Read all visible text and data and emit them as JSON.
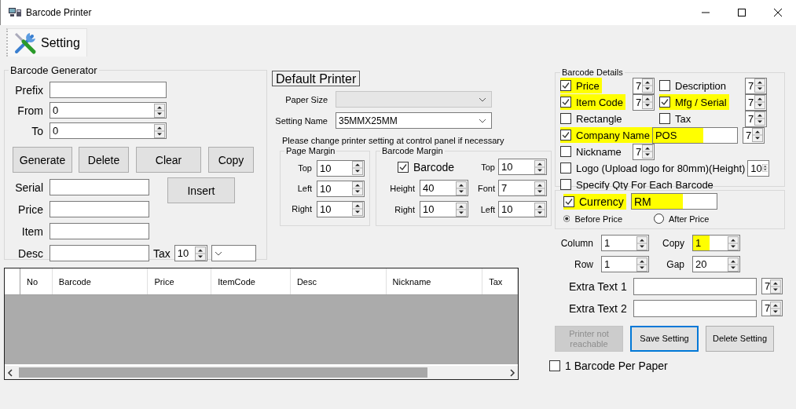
{
  "window": {
    "title": "Barcode Printer"
  },
  "toolbar": {
    "label": "Setting"
  },
  "generator": {
    "title": "Barcode Generator",
    "fields": [
      {
        "label": "Prefix",
        "kind": "text"
      },
      {
        "label": "From",
        "kind": "spin",
        "value": "0"
      },
      {
        "label": "To",
        "kind": "spin",
        "value": "0"
      }
    ],
    "buttons": [
      "Generate",
      "Delete",
      "Clear",
      "Copy"
    ],
    "item_fields": [
      {
        "label": "Serial"
      },
      {
        "label": "Price"
      },
      {
        "label": "Item"
      },
      {
        "label": "Desc"
      }
    ],
    "insert_button": "Insert",
    "tax": {
      "label": "Tax",
      "value": "10"
    }
  },
  "table": {
    "columns": [
      "No",
      "Barcode",
      "Price",
      "ItemCode",
      "Desc",
      "Nickname",
      "Tax"
    ]
  },
  "printer": {
    "title": "Default Printer",
    "paper_size": {
      "label": "Paper Size",
      "disabled": true
    },
    "setting_name": {
      "label": "Setting Name",
      "value": "35MMX25MM",
      "disabled": false
    },
    "note": "Please change printer setting at control panel if necessary",
    "page_margin": {
      "title": "Page Margin",
      "fields": [
        {
          "label": "Top",
          "value": "10"
        },
        {
          "label": "Left",
          "value": "10"
        },
        {
          "label": "Right",
          "value": "10"
        }
      ]
    },
    "barcode_margin": {
      "title": "Barcode Margin",
      "cells": [
        {
          "kind": "check",
          "label": "Barcode",
          "checked": true
        },
        {
          "kind": "spin",
          "label": "Top",
          "value": "10"
        },
        {
          "kind": "spin",
          "label": "Height",
          "value": "40"
        },
        {
          "kind": "spin",
          "label": "Font",
          "value": "7"
        },
        {
          "kind": "spin",
          "label": "Right",
          "value": "10"
        },
        {
          "kind": "spin",
          "label": "Left",
          "value": "10"
        }
      ]
    }
  },
  "details": {
    "title": "Barcode Details",
    "rows": [
      [
        {
          "kind": "check",
          "label": "Price",
          "checked": true,
          "highlighted": true
        },
        {
          "kind": "spin",
          "value": "7"
        },
        {
          "kind": "check",
          "label": "Description",
          "checked": false,
          "highlighted": false
        },
        {
          "kind": "spin",
          "value": "7"
        }
      ],
      [
        {
          "kind": "check",
          "label": "Item Code",
          "checked": true,
          "highlighted": true
        },
        {
          "kind": "spin",
          "value": "7"
        },
        {
          "kind": "check",
          "label": "Mfg / Serial",
          "checked": true,
          "highlighted": true
        },
        {
          "kind": "spin",
          "value": "7"
        }
      ],
      [
        {
          "kind": "check",
          "label": "Rectangle",
          "checked": false,
          "highlighted": false
        },
        {
          "kind": "gap"
        },
        {
          "kind": "check",
          "label": "Tax",
          "checked": false,
          "highlighted": false
        },
        {
          "kind": "spin",
          "value": "7"
        }
      ],
      [
        {
          "kind": "check",
          "label": "Company Name",
          "checked": true,
          "highlighted": true
        },
        {
          "kind": "text",
          "value": "POS",
          "highlighted": true
        },
        {
          "kind": "spin",
          "value": "7"
        }
      ],
      [
        {
          "kind": "check",
          "label": "Nickname",
          "checked": false,
          "highlighted": false
        },
        {
          "kind": "spin",
          "value": "7"
        }
      ],
      [
        {
          "kind": "check",
          "label": "Logo (Upload logo for 80mm)(Height)",
          "checked": false,
          "highlighted": false
        },
        {
          "kind": "spin",
          "value": "10"
        }
      ],
      [
        {
          "kind": "check",
          "label": "Specify Qty For Each  Barcode",
          "checked": false,
          "highlighted": false
        }
      ]
    ]
  },
  "currency": {
    "check": {
      "label": "Currency",
      "checked": true,
      "highlighted": true
    },
    "value": "RM",
    "value_highlighted": true,
    "radios": [
      {
        "label": "Before Price",
        "selected": true
      },
      {
        "label": "After Price",
        "selected": false
      }
    ]
  },
  "layout_fields": [
    {
      "label": "Column",
      "value": "1",
      "highlighted": false
    },
    {
      "label": "Copy",
      "value": "1",
      "highlighted": true
    },
    {
      "label": "Row",
      "value": "1",
      "highlighted": false
    },
    {
      "label": "Gap",
      "value": "20",
      "highlighted": false
    }
  ],
  "extra_texts": [
    {
      "label": "Extra Text 1",
      "size": "7"
    },
    {
      "label": "Extra Text 2",
      "size": "7"
    }
  ],
  "actions": [
    {
      "label": "Printer not reachable",
      "disabled": true,
      "focused": false
    },
    {
      "label": "Save Setting",
      "disabled": false,
      "focused": true
    },
    {
      "label": "Delete Setting",
      "disabled": false,
      "focused": false
    }
  ],
  "per_paper": {
    "label": "1 Barcode Per Paper",
    "checked": false
  }
}
